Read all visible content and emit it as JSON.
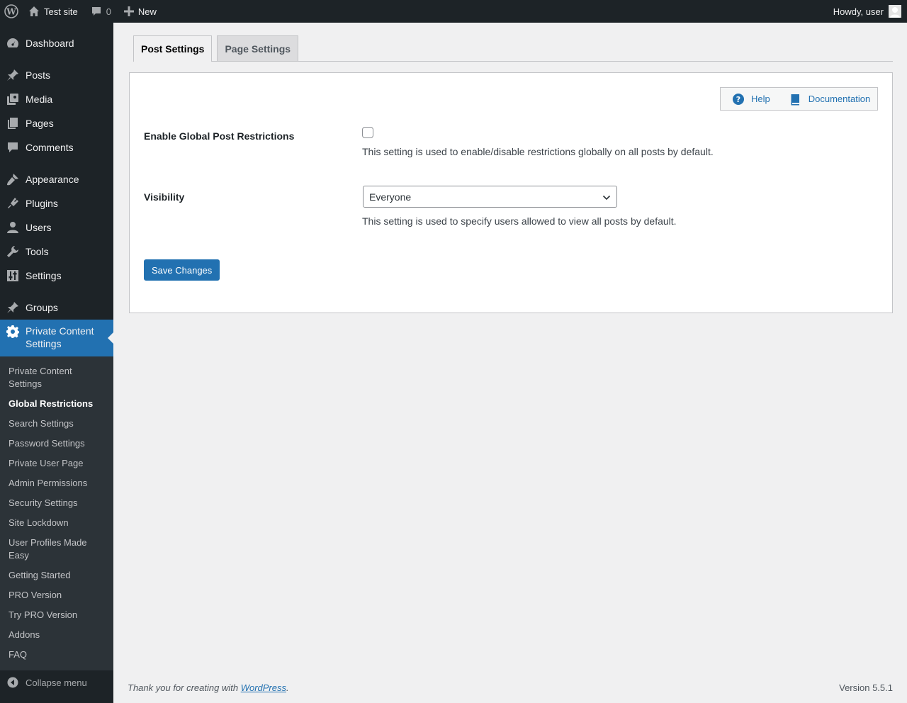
{
  "admin_bar": {
    "site_name": "Test site",
    "comments_count": "0",
    "new_label": "New",
    "howdy": "Howdy, user"
  },
  "sidebar": {
    "items": [
      {
        "label": "Dashboard",
        "icon": "dashboard-icon"
      },
      {
        "label": "Posts",
        "icon": "pushpin-icon"
      },
      {
        "label": "Media",
        "icon": "media-icon"
      },
      {
        "label": "Pages",
        "icon": "pages-icon"
      },
      {
        "label": "Comments",
        "icon": "comment-icon"
      },
      {
        "label": "Appearance",
        "icon": "paintbrush-icon"
      },
      {
        "label": "Plugins",
        "icon": "plugin-icon"
      },
      {
        "label": "Users",
        "icon": "user-icon"
      },
      {
        "label": "Tools",
        "icon": "wrench-icon"
      },
      {
        "label": "Settings",
        "icon": "sliders-icon"
      },
      {
        "label": "Groups",
        "icon": "pushpin-icon"
      },
      {
        "label": "Private Content Settings",
        "icon": "gear-icon"
      }
    ],
    "submenu": [
      "Private Content Settings",
      "Global Restrictions",
      "Search Settings",
      "Password Settings",
      "Private User Page",
      "Admin Permissions",
      "Security Settings",
      "Site Lockdown",
      "User Profiles Made Easy",
      "Getting Started",
      "PRO Version",
      "Try PRO Version",
      "Addons",
      "FAQ"
    ],
    "collapse_label": "Collapse menu"
  },
  "tabs": [
    "Post Settings",
    "Page Settings"
  ],
  "help": {
    "help_label": "Help",
    "documentation_label": "Documentation"
  },
  "form": {
    "enable_label": "Enable Global Post Restrictions",
    "enable_checked": false,
    "enable_desc": "This setting is used to enable/disable restrictions globally on all posts by default.",
    "visibility_label": "Visibility",
    "visibility_value": "Everyone",
    "visibility_desc": "This setting is used to specify users allowed to view all posts by default.",
    "save_label": "Save Changes"
  },
  "footer": {
    "thanks_prefix": "Thank you for creating with ",
    "thanks_link": "WordPress",
    "thanks_suffix": ".",
    "version": "Version 5.5.1"
  },
  "colors": {
    "admin_dark": "#1d2327",
    "submenu_bg": "#2c3338",
    "accent": "#2271b1",
    "page_bg": "#f0f0f1"
  }
}
